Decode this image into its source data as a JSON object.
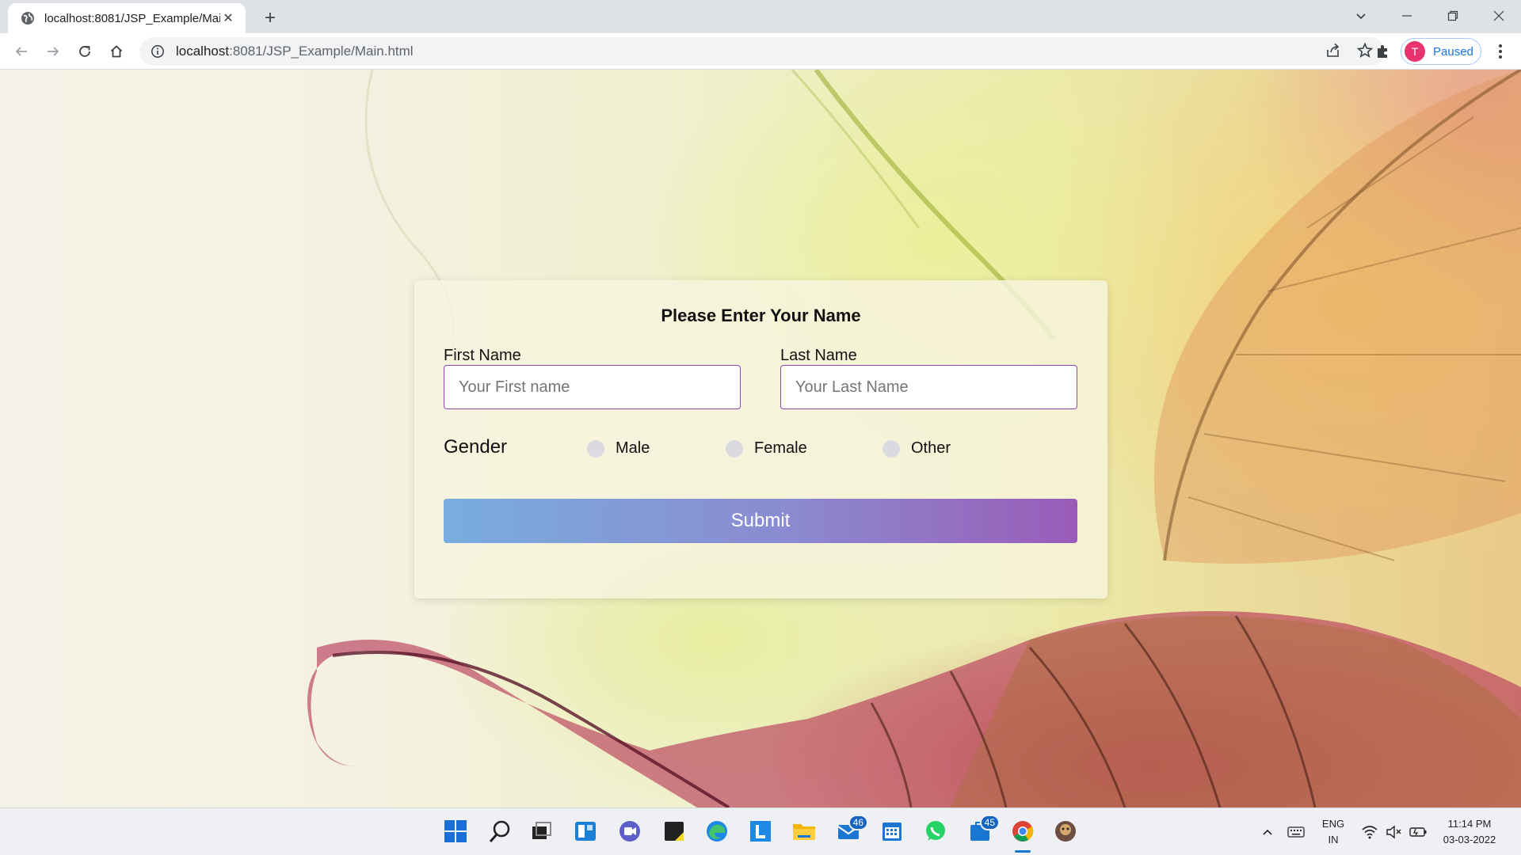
{
  "browser": {
    "tab_title": "localhost:8081/JSP_Example/Mai",
    "new_tab_symbol": "+",
    "close_tab_symbol": "✕",
    "url_host": "localhost",
    "url_path": ":8081/JSP_Example/Main.html",
    "profile_initial": "T",
    "profile_status": "Paused"
  },
  "form": {
    "heading": "Please Enter Your Name",
    "first_name_label": "First Name",
    "first_name_placeholder": "Your First name",
    "last_name_label": "Last Name",
    "last_name_placeholder": "Your Last Name",
    "gender_label": "Gender",
    "gender_options": [
      "Male",
      "Female",
      "Other"
    ],
    "submit_label": "Submit"
  },
  "taskbar": {
    "mail_badge": "46",
    "store_badge": "45",
    "language": "ENG",
    "region": "IN",
    "time": "11:14 PM",
    "date": "03-03-2022"
  },
  "colors": {
    "accent_purple": "#8e44ad",
    "submit_gradient_start": "#79addf",
    "submit_gradient_end": "#9a5cb8",
    "profile_avatar": "#e8336e",
    "profile_text": "#1a73e8"
  }
}
